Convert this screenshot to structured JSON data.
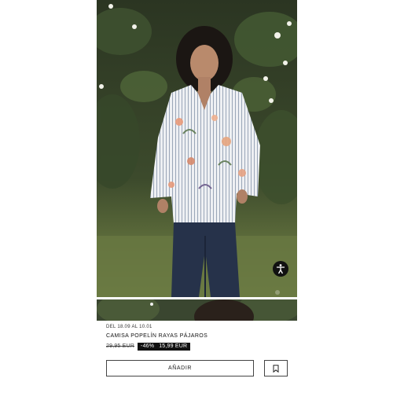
{
  "product": {
    "promo_dates": "DEL 18.09 AL 10.01",
    "name": "CAMISA POPELÍN RAYAS PÁJAROS",
    "old_price": "29,95 EUR",
    "discount": "-46%",
    "sale_price": "15,99 EUR"
  },
  "actions": {
    "add_label": "AÑADIR"
  },
  "icons": {
    "accessibility": "accessibility-icon",
    "bookmark": "bookmark-icon"
  },
  "colors": {
    "badge_background": "#111111",
    "button_border": "#444444"
  }
}
